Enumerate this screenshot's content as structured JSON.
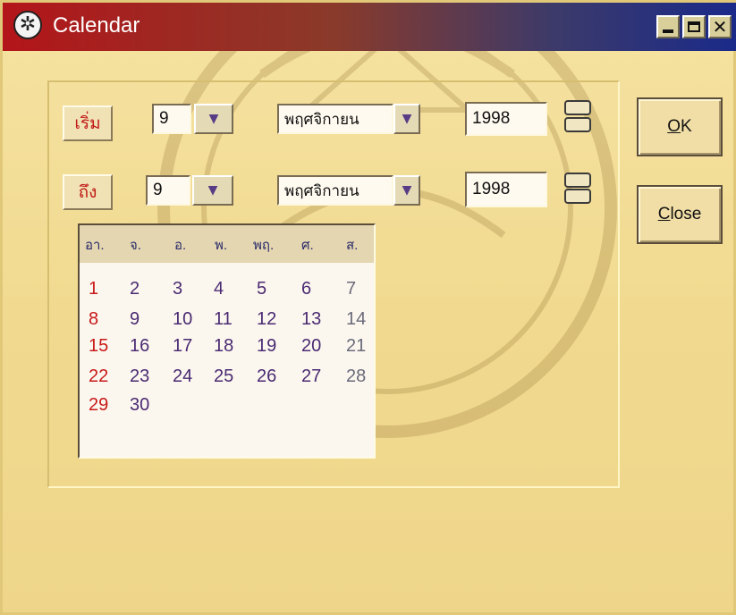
{
  "window": {
    "title": "Calendar"
  },
  "titlebar": {
    "minimize_icon": "minimize-icon",
    "maximize_icon": "maximize-icon",
    "close_icon": "close-icon"
  },
  "from_row": {
    "label": "เริ่ม",
    "day": "9",
    "month": "พฤศจิกายน",
    "year": "1998"
  },
  "to_row": {
    "label": "ถึง",
    "day": "9",
    "month": "พฤศจิกายน",
    "year": "1998"
  },
  "buttons": {
    "ok_underlined": "O",
    "ok_rest": "K",
    "close_underlined": "C",
    "close_rest": "lose"
  },
  "calendar": {
    "weekdays": [
      "อา.",
      "จ.",
      "อ.",
      "พ.",
      "พฤ.",
      "ศ.",
      "ส."
    ],
    "days": [
      [
        "1",
        "2",
        "3",
        "4",
        "5",
        "6",
        "7"
      ],
      [
        "8",
        "9",
        "10",
        "11",
        "12",
        "13",
        "14"
      ],
      [
        "15",
        "16",
        "17",
        "18",
        "19",
        "20",
        "21"
      ],
      [
        "22",
        "23",
        "24",
        "25",
        "26",
        "27",
        "28"
      ],
      [
        "29",
        "30",
        "",
        "",
        "",
        "",
        ""
      ]
    ]
  },
  "colors": {
    "title_start": "#b3151a",
    "title_end": "#1a2a8a",
    "sunday": "#c81818",
    "weekday": "#4a2a72"
  }
}
